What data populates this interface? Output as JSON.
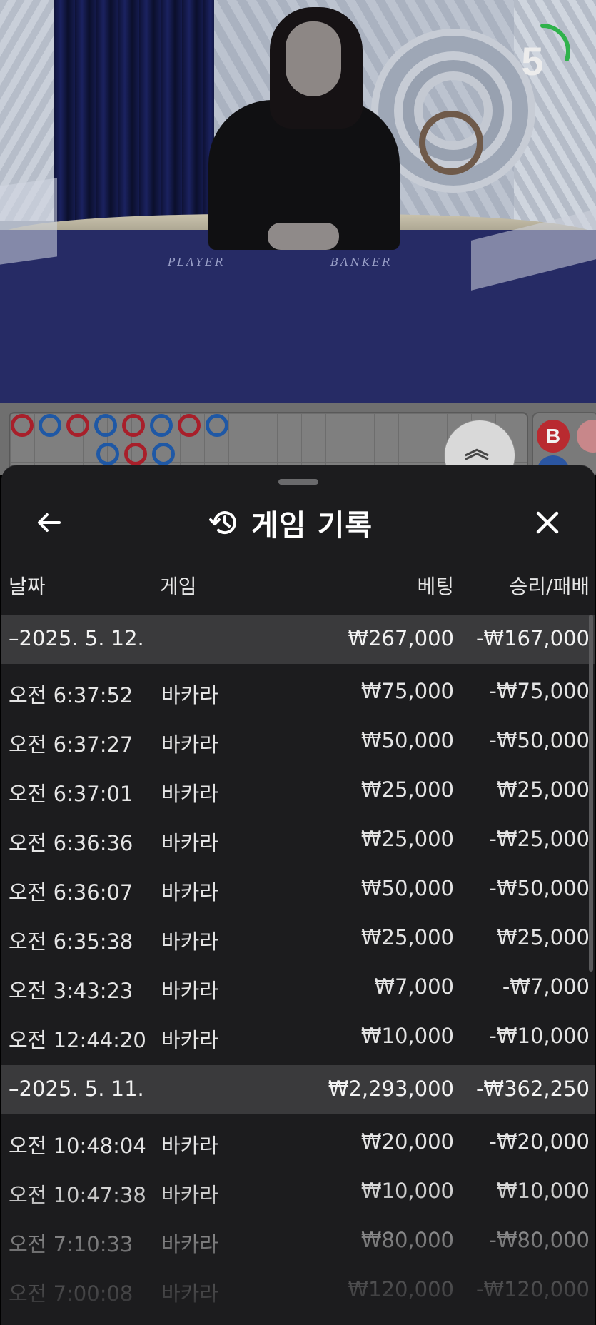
{
  "video": {
    "timer_value": "5",
    "timer_progress": 0.3,
    "timer_color": "#2fb24b",
    "table_labels": [
      "PLAYER",
      "BANKER"
    ]
  },
  "roadmap": {
    "bead_row1": [
      "b",
      "p",
      "b",
      "p",
      "b",
      "p",
      "b",
      "p"
    ],
    "bead_row2": [
      "p",
      "b",
      "p"
    ],
    "collapse_icon": "double-chevron-up-icon",
    "prediction_label": "B",
    "colors": {
      "player": "#1f58a5",
      "banker": "#a81f2a"
    }
  },
  "sheet": {
    "back_icon": "arrow-left-icon",
    "history_icon": "history-clock-icon",
    "title": "게임 기록",
    "close_icon": "close-icon",
    "columns": {
      "date": "날짜",
      "game": "게임",
      "bet": "베팅",
      "win_loss": "승리/패배"
    },
    "groups": [
      {
        "date": "–2025. 5. 12.",
        "total_bet": "₩267,000",
        "total_win_loss": "-₩167,000",
        "rows": [
          {
            "time": "오전 6:37:52",
            "game": "바카라",
            "bet": "₩75,000",
            "win_loss": "-₩75,000"
          },
          {
            "time": "오전 6:37:27",
            "game": "바카라",
            "bet": "₩50,000",
            "win_loss": "-₩50,000"
          },
          {
            "time": "오전 6:37:01",
            "game": "바카라",
            "bet": "₩25,000",
            "win_loss": "₩25,000"
          },
          {
            "time": "오전 6:36:36",
            "game": "바카라",
            "bet": "₩25,000",
            "win_loss": "-₩25,000"
          },
          {
            "time": "오전 6:36:07",
            "game": "바카라",
            "bet": "₩50,000",
            "win_loss": "-₩50,000"
          },
          {
            "time": "오전 6:35:38",
            "game": "바카라",
            "bet": "₩25,000",
            "win_loss": "₩25,000"
          },
          {
            "time": "오전 3:43:23",
            "game": "바카라",
            "bet": "₩7,000",
            "win_loss": "-₩7,000"
          },
          {
            "time": "오전 12:44:20",
            "game": "바카라",
            "bet": "₩10,000",
            "win_loss": "-₩10,000"
          }
        ]
      },
      {
        "date": "–2025. 5. 11.",
        "total_bet": "₩2,293,000",
        "total_win_loss": "-₩362,250",
        "rows": [
          {
            "time": "오전 10:48:04",
            "game": "바카라",
            "bet": "₩20,000",
            "win_loss": "-₩20,000"
          },
          {
            "time": "오전 10:47:38",
            "game": "바카라",
            "bet": "₩10,000",
            "win_loss": "₩10,000"
          },
          {
            "time": "오전 7:10:33",
            "game": "바카라",
            "bet": "₩80,000",
            "win_loss": "-₩80,000"
          },
          {
            "time": "오전 7:00:08",
            "game": "바카라",
            "bet": "₩120,000",
            "win_loss": "-₩120,000"
          }
        ]
      }
    ]
  }
}
